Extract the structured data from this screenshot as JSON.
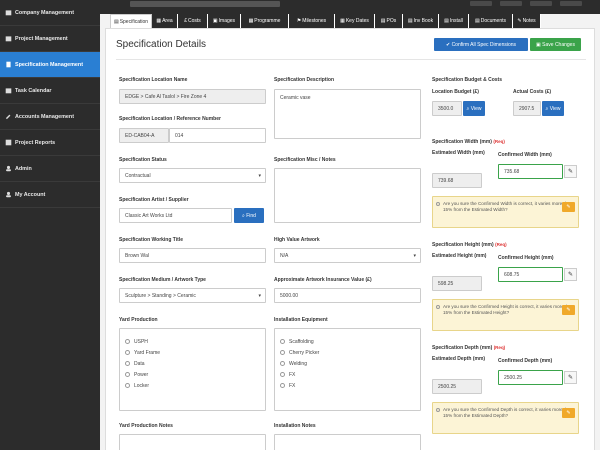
{
  "sidebar": {
    "items": [
      {
        "label": "Company Management",
        "icon": "building-icon"
      },
      {
        "label": "Project Management",
        "icon": "folder-icon"
      },
      {
        "label": "Specification Management",
        "icon": "document-icon",
        "active": true
      },
      {
        "label": "Task Calendar",
        "icon": "calendar-icon"
      },
      {
        "label": "Accounts Management",
        "icon": "wrench-icon"
      },
      {
        "label": "Project Reports",
        "icon": "report-icon"
      },
      {
        "label": "Admin",
        "icon": "user-icon"
      },
      {
        "label": "My Account",
        "icon": "user-icon"
      }
    ]
  },
  "tabs": [
    {
      "label": "Specification",
      "active": true
    },
    {
      "label": "Area"
    },
    {
      "label": "Costs"
    },
    {
      "label": "Images"
    },
    {
      "label": "Programme"
    },
    {
      "label": "Milestones"
    },
    {
      "label": "Key Dates"
    },
    {
      "label": "POs"
    },
    {
      "label": "Inv Book"
    },
    {
      "label": "Install"
    },
    {
      "label": "Documents"
    },
    {
      "label": "Notes"
    }
  ],
  "header": {
    "title": "Specification Details",
    "confirm_button": "Confirm All Spec Dimensions",
    "save_button": "Save Changes"
  },
  "form": {
    "location_name": {
      "label": "Specification Location Name",
      "value": "EDGE > Cafe Al Taslol > Fire Zone 4"
    },
    "location_ref": {
      "label": "Specification Location / Reference Number",
      "prefix": "ED-CAB04-A",
      "value": "014"
    },
    "status": {
      "label": "Specification Status",
      "value": "Contractual"
    },
    "artist": {
      "label": "Specification Artist / Supplier",
      "value": "Classic Art Works Ltd",
      "find": "Find"
    },
    "working_title": {
      "label": "Specification Working Title",
      "value": "Brown Wal"
    },
    "medium": {
      "label": "Specification Medium / Artwork Type",
      "value": "Sculpture > Standing > Ceramic"
    },
    "yard_production": {
      "label": "Yard Production",
      "items": [
        "USPH",
        "Yard Frame",
        "Data",
        "Power",
        "Locker"
      ]
    },
    "yard_notes": {
      "label": "Yard Production Notes"
    },
    "description": {
      "label": "Specification Description",
      "value": "Ceramic vase"
    },
    "misc_notes": {
      "label": "Specification Misc / Notes"
    },
    "high_value": {
      "label": "High Value Artwork",
      "value": "N/A"
    },
    "insurance": {
      "label": "Approximate Artwork Insurance Value (£)",
      "value": "5000.00"
    },
    "install_equipment": {
      "label": "Installation Equipment",
      "items": [
        "Scaffolding",
        "Cherry Picker",
        "Welding",
        "FX",
        "FX"
      ]
    },
    "install_notes": {
      "label": "Installation Notes"
    }
  },
  "budget": {
    "title": "Specification Budget & Costs",
    "location_budget_label": "Location Budget (£)",
    "location_budget": "3500.0",
    "actual_costs_label": "Actual Costs (£)",
    "actual_costs": "2907.5",
    "view": "View"
  },
  "width": {
    "title": "Specification Width (mm)",
    "req": "(Req)",
    "estimated_label": "Estimated Width (mm)",
    "estimated": "739.68",
    "confirmed_label": "Confirmed Width (mm)",
    "confirmed": "735.68",
    "warning": "Are you sure the Confirmed Width is correct, it varies more than 15% from the Estimated Width?"
  },
  "height": {
    "title": "Specification Height (mm)",
    "req": "(Req)",
    "estimated_label": "Estimated Height (mm)",
    "estimated": "598.25",
    "confirmed_label": "Confirmed Height (mm)",
    "confirmed": "608.75",
    "warning": "Are you sure the Confirmed Height is correct, it varies more than 15% from the Estimated Height?"
  },
  "depth": {
    "title": "Specification Depth (mm)",
    "req": "(Req)",
    "estimated_label": "Estimated Depth (mm)",
    "estimated": "2500.25",
    "confirmed_label": "Confirmed Depth (mm)",
    "confirmed": "2500.25",
    "warning": "Are you sure the Confirmed Depth is correct, it varies more than 15% from the Estimated Depth?"
  },
  "colors": {
    "sidebar_bg": "#2c2c2c",
    "accent_blue": "#2a7fd3",
    "btn_blue": "#2a6fbf",
    "btn_green": "#3aa34a",
    "warn_bg": "#fcf4d6",
    "warn_btn": "#f0a92a"
  }
}
